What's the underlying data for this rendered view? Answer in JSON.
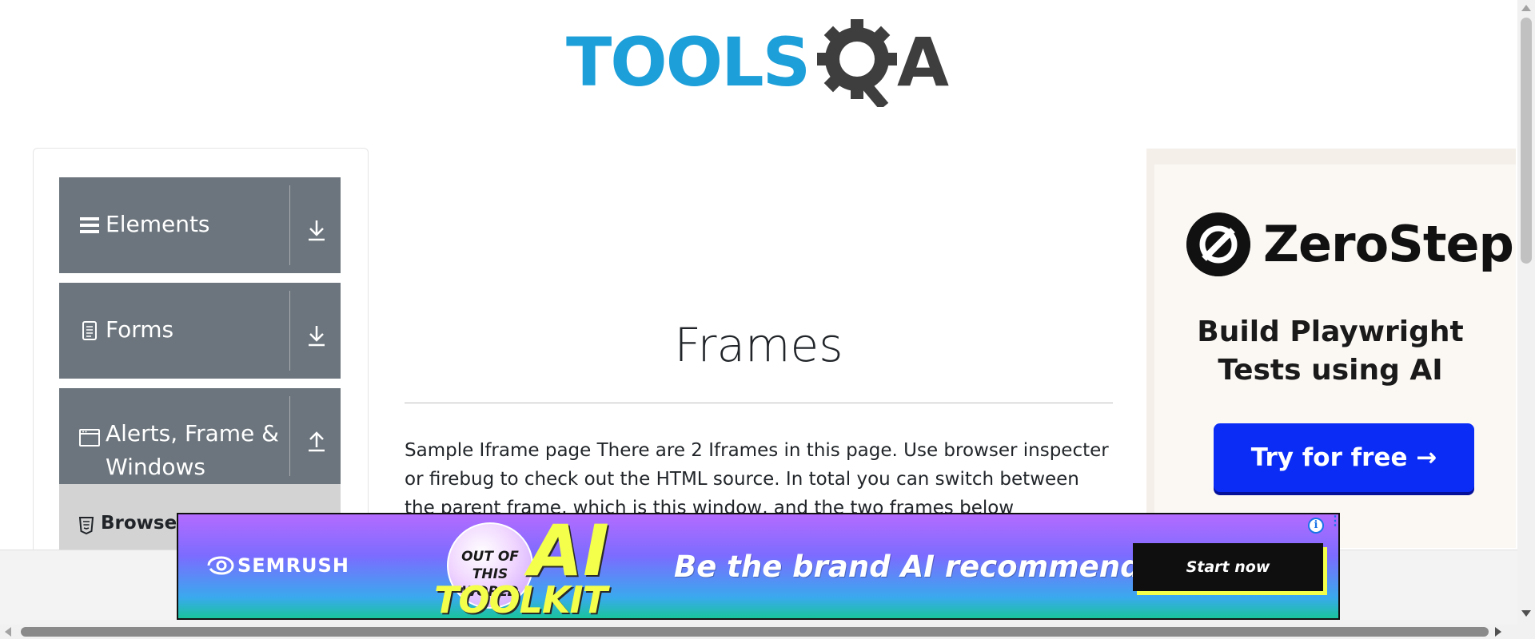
{
  "header": {
    "logo_part1": "TOOLS",
    "logo_part2": "A",
    "logo_icon": "gear-magnifier-icon"
  },
  "sidebar": {
    "groups": [
      {
        "label": "Elements",
        "icon": "hamburger-icon",
        "toggle_icon": "download-arrow-icon"
      },
      {
        "label": "Forms",
        "icon": "document-icon",
        "toggle_icon": "download-arrow-icon"
      },
      {
        "label_line1": "Alerts, Frame &",
        "label_line2": "Windows",
        "icon": "window-icon",
        "toggle_icon": "upload-arrow-icon"
      }
    ],
    "active_item": {
      "label": "Browser",
      "icon": "html5-icon"
    }
  },
  "main": {
    "title": "Frames",
    "description": "Sample Iframe page There are 2 Iframes in this page. Use browser inspecter or firebug to check out the HTML source. In total you can switch between the parent frame, which is this window, and the two frames below"
  },
  "ad_right": {
    "brand": "ZeroStep",
    "headline": "Build Playwright Tests using AI",
    "cta": "Try for free →",
    "colors": {
      "cta": "#0a2cf5",
      "background": "#fbf8f4"
    }
  },
  "ad_bottom": {
    "brand": "SEMRUSH",
    "badge_line1": "OUT OF THIS",
    "badge_line2": "WORLD",
    "ai": "AI",
    "toolkit": "TOOLKIT",
    "headline": "Be the brand AI recommends",
    "cta": "Start now",
    "info_glyph": "i",
    "menu_glyph": "⋮",
    "colors": {
      "accent": "#f3ff4b",
      "cta": "#0f0f0f"
    }
  },
  "colors": {
    "logo_blue": "#1d9fd9",
    "logo_dark": "#3e3e3e",
    "sidebar_group": "#6c757d",
    "sidebar_active": "#d3d3d3"
  }
}
